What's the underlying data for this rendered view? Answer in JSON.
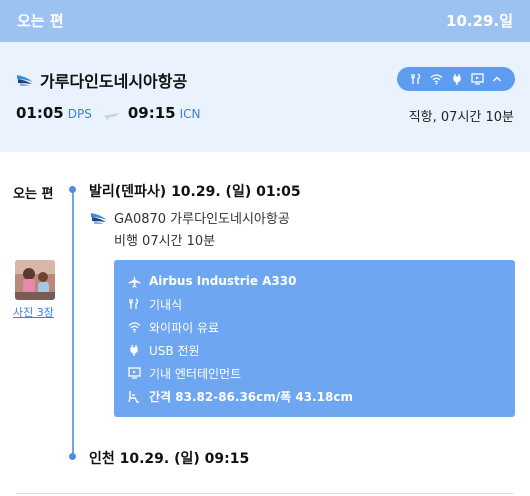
{
  "header": {
    "title": "오는 편",
    "date": "10.29.일"
  },
  "summary": {
    "airline": "가루다인도네시아항공",
    "departure_time": "01:05",
    "departure_code": "DPS",
    "arrival_time": "09:15",
    "arrival_code": "ICN",
    "duration_text": "직항, 07시간 10분",
    "amenity_icons": [
      "meal-icon",
      "wifi-icon",
      "usb-plug-icon",
      "entertainment-screen-icon",
      "chevron-up-icon"
    ]
  },
  "leg": {
    "label": "오는 편",
    "departure": "발리(덴파사) 10.29. (일) 01:05",
    "flight": "GA0870 가루다인도네시아항공",
    "duration": "비행 07시간 10분",
    "arrival": "인천 10.29. (일) 09:15"
  },
  "photo": {
    "link_text": "사진 3장"
  },
  "details": [
    {
      "icon": "airplane-icon",
      "text": "Airbus Industrie A330",
      "bold": true
    },
    {
      "icon": "meal-icon",
      "text": "기내식",
      "bold": false
    },
    {
      "icon": "wifi-icon",
      "text": "와이파이 유료",
      "bold": false
    },
    {
      "icon": "usb-plug-icon",
      "text": "USB 전원",
      "bold": false
    },
    {
      "icon": "entertainment-screen-icon",
      "text": "기내 엔터테인먼트",
      "bold": false
    },
    {
      "icon": "seat-pitch-icon",
      "text": "간격 83.82-86.36cm/폭 43.18cm",
      "bold": true
    }
  ],
  "colors": {
    "header_bg": "#9cc2f2",
    "summary_bg": "#eaf2fd",
    "accent": "#3d7fe0",
    "detail_box": "#6ea6f2"
  }
}
